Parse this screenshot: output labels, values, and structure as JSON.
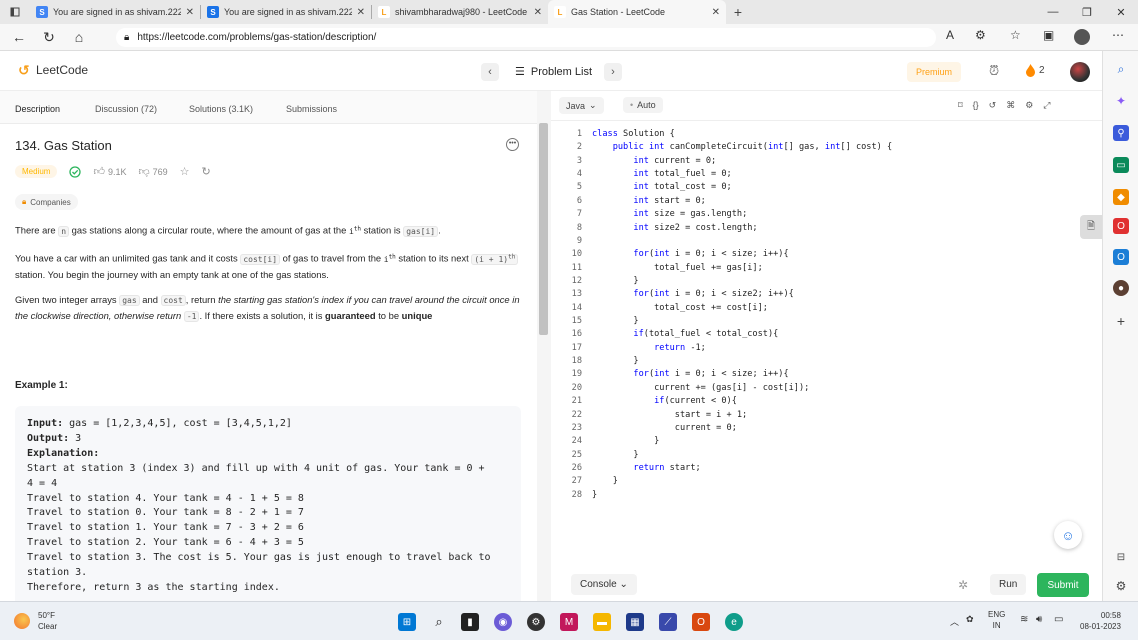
{
  "browser": {
    "tabs": [
      {
        "title": "You are signed in as shivam.2226",
        "favicon": "S",
        "color": "#4285f4"
      },
      {
        "title": "You are signed in as shivam.2226",
        "favicon": "S",
        "color": "#1a73e8"
      },
      {
        "title": "shivambharadwaj980 - LeetCode",
        "favicon": "L",
        "color": "#333333"
      },
      {
        "title": "Gas Station - LeetCode",
        "favicon": "L",
        "color": "#333333"
      }
    ],
    "url": "https://leetcode.com/problems/gas-station/description/"
  },
  "header": {
    "logo": "LeetCode",
    "problem_list": "Problem List",
    "premium": "Premium",
    "streak": "2"
  },
  "left": {
    "tabs": [
      "Description",
      "Discussion (72)",
      "Solutions (3.1K)",
      "Submissions"
    ],
    "title": "134. Gas Station",
    "difficulty": "Medium",
    "likes": "9.1K",
    "dislikes": "769",
    "companies": "Companies",
    "example_title": "Example 1:"
  },
  "editor": {
    "language": "Java",
    "mode": "Auto",
    "lines": [
      "class Solution {",
      "    public int canCompleteCircuit(int[] gas, int[] cost) {",
      "        int current = 0;",
      "        int total_fuel = 0;",
      "        int total_cost = 0;",
      "        int start = 0;",
      "        int size = gas.length;",
      "        int size2 = cost.length;",
      "",
      "        for(int i = 0; i < size; i++){",
      "            total_fuel += gas[i];",
      "        }",
      "        for(int i = 0; i < size2; i++){",
      "            total_cost += cost[i];",
      "        }",
      "        if(total_fuel < total_cost){",
      "            return -1;",
      "        }",
      "        for(int i = 0; i < size; i++){",
      "            current += (gas[i] - cost[i]);",
      "            if(current < 0){",
      "                start = i + 1;",
      "                current = 0;",
      "            }",
      "        }",
      "        return start;",
      "    }",
      "}"
    ],
    "console": "Console",
    "run": "Run",
    "submit": "Submit"
  },
  "taskbar": {
    "temp": "50°F",
    "weather": "Clear",
    "lang": "ENG",
    "region": "IN",
    "time": "00:58",
    "date": "08-01-2023"
  }
}
